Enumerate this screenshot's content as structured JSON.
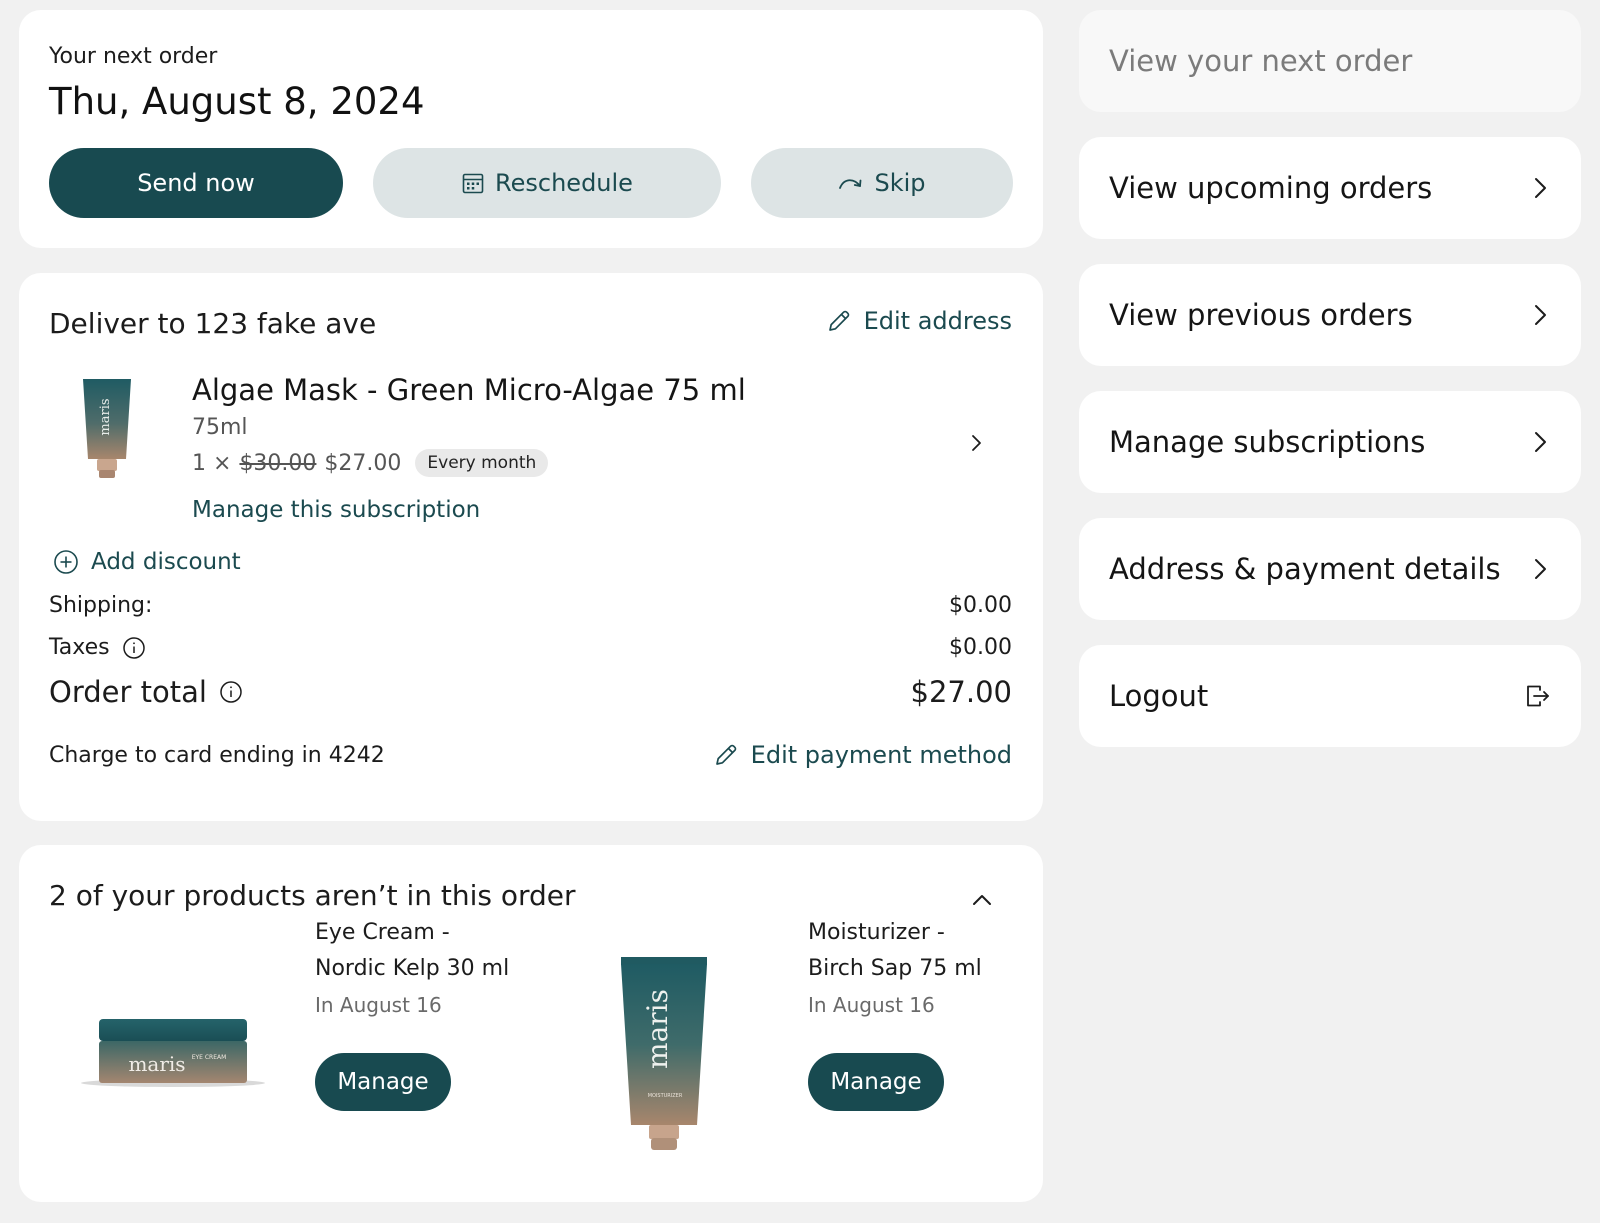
{
  "next_order": {
    "label": "Your next order",
    "date": "Thu, August 8, 2024",
    "send_now_label": "Send now",
    "reschedule_label": "Reschedule",
    "skip_label": "Skip"
  },
  "delivery": {
    "title": "Deliver to 123 fake ave",
    "edit_address_label": "Edit address",
    "product": {
      "name": "Algae Mask - Green Micro-Algae 75 ml",
      "size": "75ml",
      "quantity": "1 ×",
      "original_price": "$30.00",
      "price": "$27.00",
      "frequency_badge": "Every month",
      "brand_on_tube": "maris",
      "manage_label": "Manage this subscription"
    },
    "add_discount_label": "Add discount",
    "shipping_label": "Shipping:",
    "shipping_value": "$0.00",
    "taxes_label": "Taxes",
    "taxes_value": "$0.00",
    "total_label": "Order total",
    "total_value": "$27.00",
    "charge_text": "Charge to card ending in 4242",
    "edit_payment_label": "Edit payment method"
  },
  "not_in_order": {
    "title": "2 of your products aren’t in this order",
    "items": [
      {
        "name_line1": "Eye Cream -",
        "name_line2": "Nordic Kelp 30 ml",
        "when": "In August 16",
        "manage_label": "Manage",
        "brand": "maris",
        "label_text": "EYE CREAM"
      },
      {
        "name_line1": "Moisturizer -",
        "name_line2": "Birch Sap 75 ml",
        "when": "In August 16",
        "manage_label": "Manage",
        "brand": "maris",
        "label_text": "MOISTURIZER"
      }
    ]
  },
  "nav": {
    "items": [
      {
        "label": "View your next order",
        "icon": "none",
        "active": true
      },
      {
        "label": "View upcoming orders",
        "icon": "chevron-right-icon"
      },
      {
        "label": "View previous orders",
        "icon": "chevron-right-icon"
      },
      {
        "label": "Manage subscriptions",
        "icon": "chevron-right-icon"
      },
      {
        "label": "Address & payment details",
        "icon": "chevron-right-icon"
      },
      {
        "label": "Logout",
        "icon": "logout-icon"
      }
    ]
  },
  "colors": {
    "primary": "#184a50",
    "soft_button": "#dde4e5",
    "page_bg": "#f1f1f1",
    "card_bg": "#ffffff"
  }
}
